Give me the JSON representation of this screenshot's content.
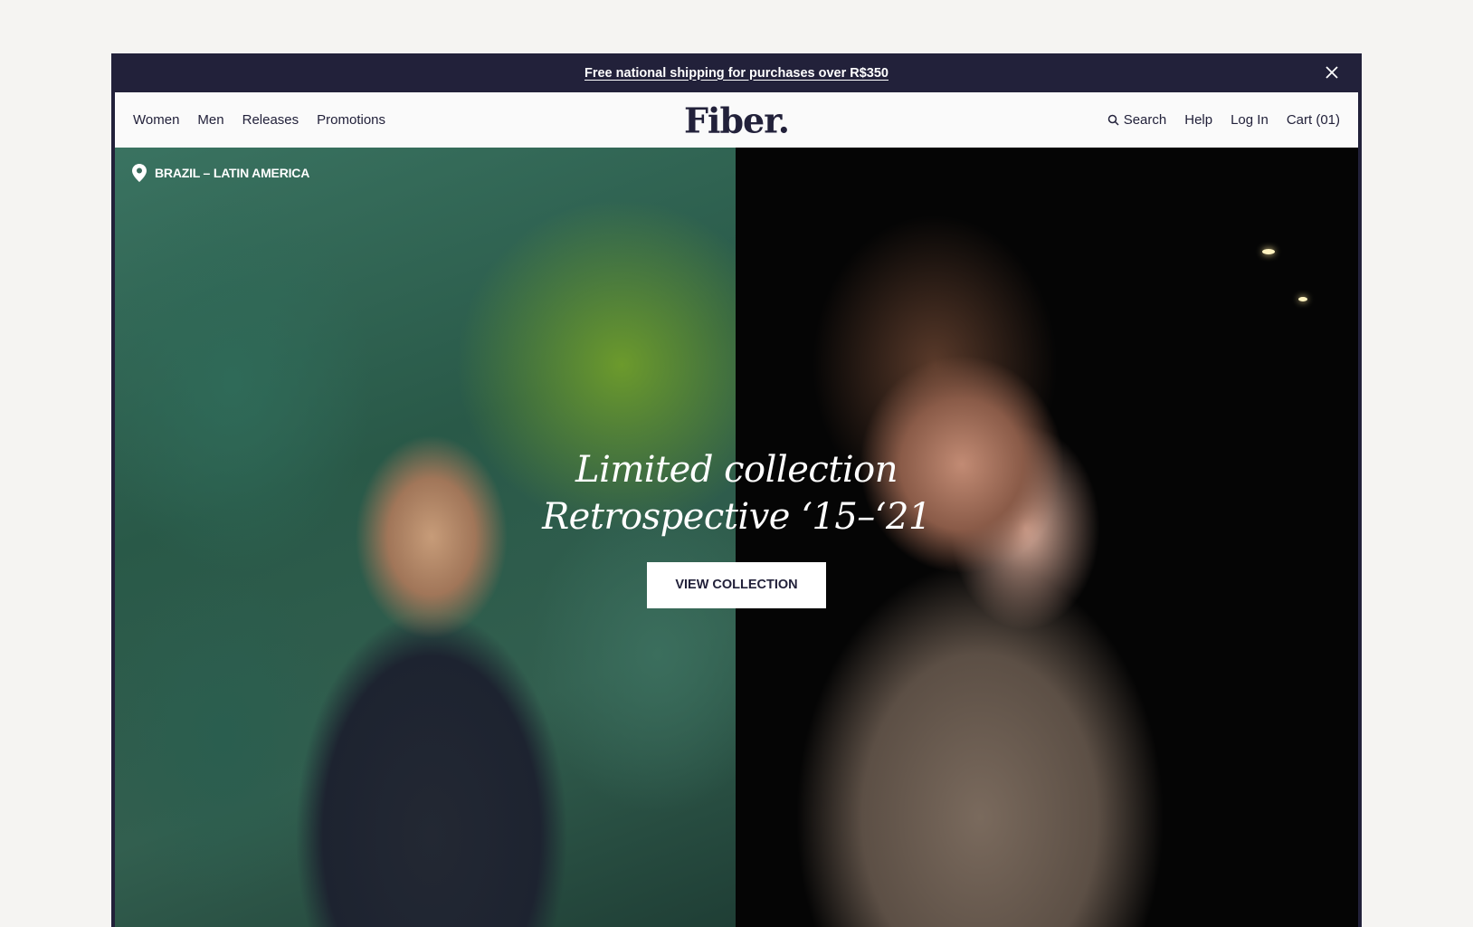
{
  "announcement": {
    "text": "Free national shipping for purchases over R$350",
    "close_icon": "close-icon"
  },
  "nav": {
    "left_items": [
      "Women",
      "Men",
      "Releases",
      "Promotions"
    ],
    "brand": "Fiber.",
    "search_label": "Search",
    "help_label": "Help",
    "login_label": "Log In",
    "cart_label": "Cart (01)"
  },
  "hero": {
    "location": "BRAZIL – LATIN AMERICA",
    "location_icon": "location-pin-icon",
    "headline_line1": "Limited collection",
    "headline_line2": "Retrospective ‘15–‘21",
    "cta_label": "VIEW COLLECTION"
  },
  "colors": {
    "bar_bg": "#22213a",
    "nav_bg": "#fafafa",
    "page_bg": "#f5f4f2"
  }
}
